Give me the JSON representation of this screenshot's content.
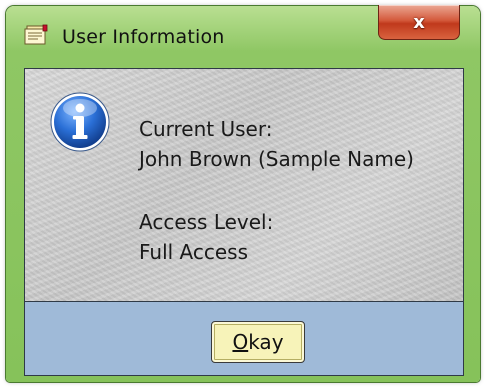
{
  "window": {
    "title": "User Information",
    "close_label": "x"
  },
  "message": {
    "current_user_label": "Current User:",
    "current_user_value": "John Brown (Sample Name)",
    "access_level_label": "Access Level:",
    "access_level_value": "Full Access"
  },
  "buttons": {
    "okay_mnemonic": "O",
    "okay_rest": "kay"
  },
  "icons": {
    "title": "notes-icon",
    "message": "info-icon"
  },
  "colors": {
    "frame": "#8fc764",
    "footer": "#9fbad8",
    "button": "#f7f3b9",
    "close": "#c0391c",
    "info": "#1f5fbf"
  }
}
